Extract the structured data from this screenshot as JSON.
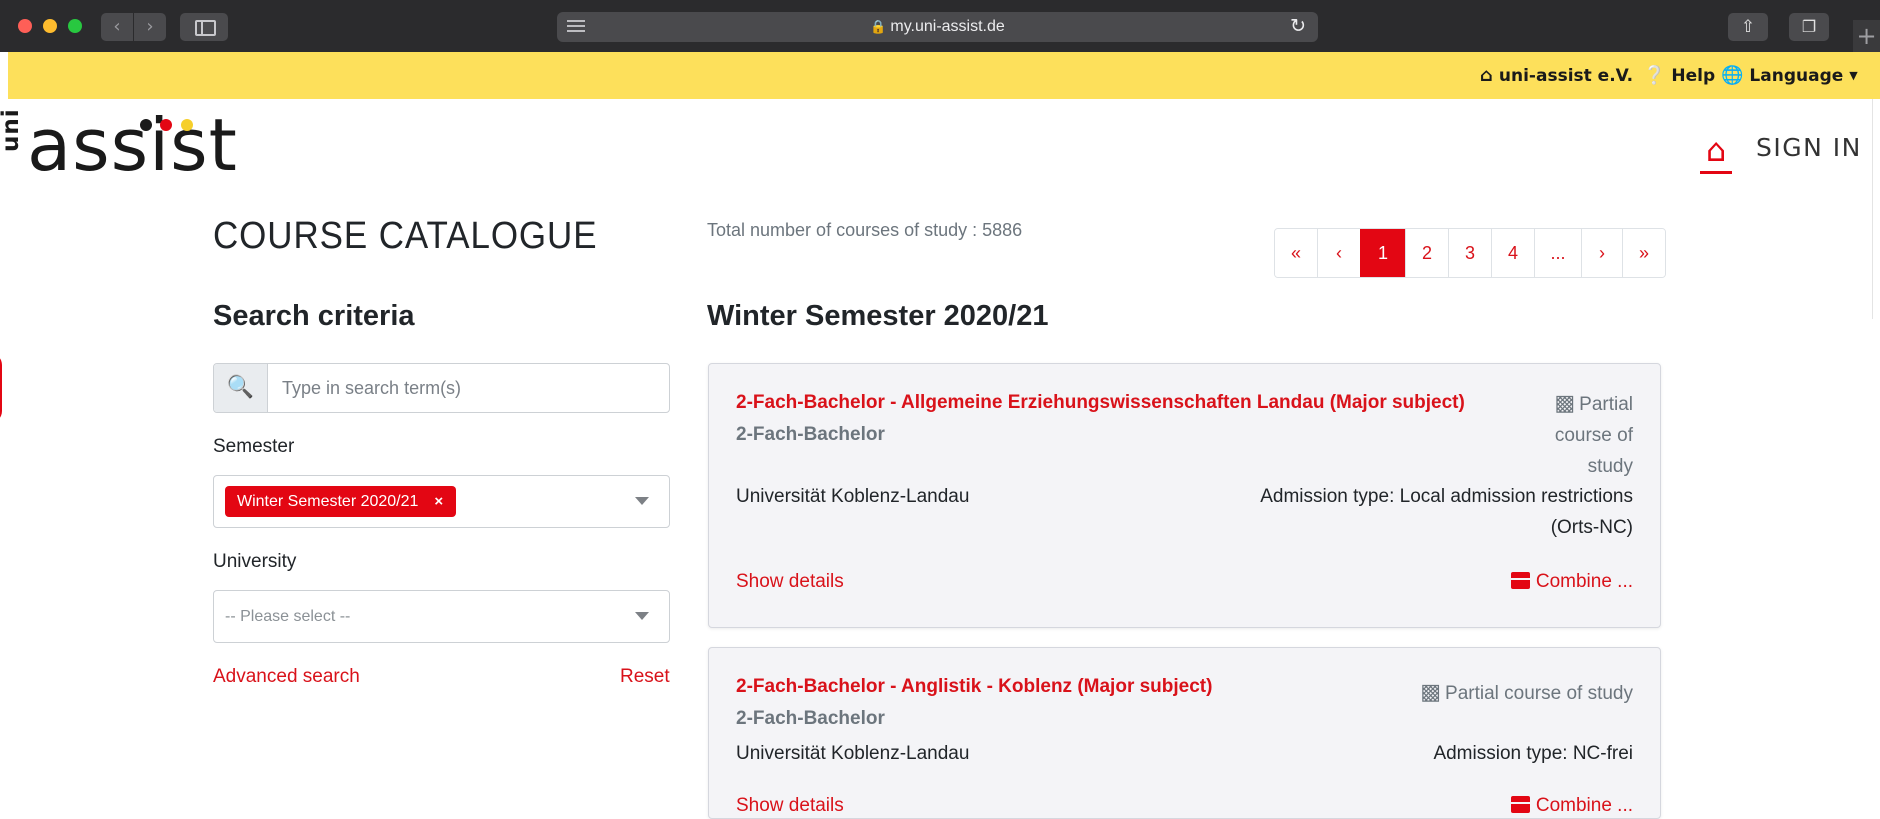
{
  "browser": {
    "url": "my.uni-assist.de",
    "back_icon": "chevron-left-icon",
    "forward_icon": "chevron-right-icon"
  },
  "topbar": {
    "home_label": "uni-assist e.V.",
    "help_label": "Help",
    "language_label": "Language"
  },
  "header": {
    "logo_text_small": "uni",
    "logo_text_main": "assist",
    "signin_label": "SIGN IN"
  },
  "left": {
    "page_title": "COURSE CATALOGUE",
    "search_heading": "Search criteria",
    "search_placeholder": "Type in search term(s)",
    "semester_label": "Semester",
    "semester_tag": "Winter Semester 2020/21",
    "semester_tag_remove": "×",
    "university_label": "University",
    "university_placeholder": "-- Please select --",
    "advanced_search": "Advanced search",
    "reset": "Reset"
  },
  "results": {
    "total": "Total number of courses of study : 5886",
    "semester_heading": "Winter Semester 2020/21",
    "pagination": [
      "«",
      "‹",
      "1",
      "2",
      "3",
      "4",
      "...",
      "›",
      "»"
    ],
    "active_page": "1",
    "courses": [
      {
        "title": "2-Fach-Bachelor - Allgemeine Erziehungswissenschaften Landau (Major subject)",
        "degree": "2-Fach-Bachelor",
        "type": "Partial course of study",
        "university": "Universität Koblenz-Landau",
        "admission": "Admission type: Local admission restrictions (Orts-NC)",
        "show_details": "Show details",
        "combine": "Combine ..."
      },
      {
        "title": "2-Fach-Bachelor - Anglistik - Koblenz (Major subject)",
        "degree": "2-Fach-Bachelor",
        "type": "Partial course of study",
        "university": "Universität Koblenz-Landau",
        "admission": "Admission type: NC-frei",
        "show_details": "Show details",
        "combine": "Combine ..."
      }
    ]
  },
  "colors": {
    "accent": "#e30613",
    "topbar": "#fde05b",
    "card_bg": "#f4f4f7"
  }
}
